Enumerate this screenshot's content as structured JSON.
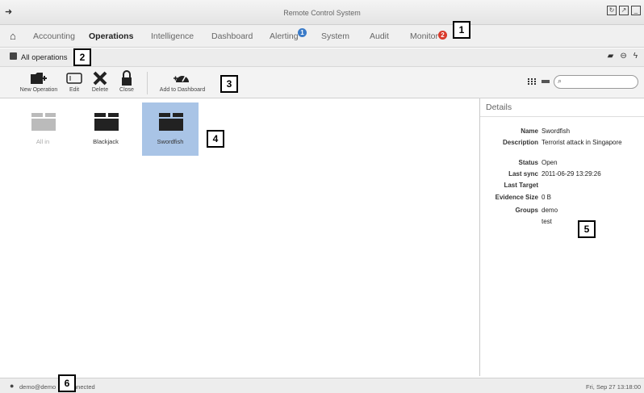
{
  "window": {
    "title": "Remote Control System"
  },
  "nav": {
    "items": [
      "Accounting",
      "Operations",
      "Intelligence",
      "Dashboard",
      "Alerting",
      "System",
      "Audit",
      "Monitor"
    ],
    "alerting_badge": "1",
    "monitor_badge": "2",
    "active": "Operations"
  },
  "section": {
    "title": "All operations"
  },
  "toolbar": {
    "new_operation": "New Operation",
    "edit": "Edit",
    "delete": "Delete",
    "close": "Close",
    "add_to_dashboard": "Add to Dashboard"
  },
  "search": {
    "placeholder": ""
  },
  "operations": [
    {
      "name": "All in",
      "state": "closed"
    },
    {
      "name": "Blackjack",
      "state": "open"
    },
    {
      "name": "Swordfish",
      "state": "open",
      "selected": true
    }
  ],
  "details": {
    "title": "Details",
    "name_label": "Name",
    "name_value": "Swordfish",
    "description_label": "Description",
    "description_value": "Terrorist attack in Singapore",
    "status_label": "Status",
    "status_value": "Open",
    "last_sync_label": "Last sync",
    "last_sync_value": "2011-06-29 13:29:26",
    "last_target_label": "Last Target",
    "last_target_value": "",
    "evidence_size_label": "Evidence Size",
    "evidence_size_value": "0 B",
    "groups_label": "Groups",
    "groups": [
      "demo",
      "test"
    ]
  },
  "status": {
    "user": "demo@demo",
    "connection": "nnected",
    "datetime": "Fri, Sep 27  13:18:00"
  },
  "callouts": [
    "1",
    "2",
    "3",
    "4",
    "5",
    "6"
  ],
  "colors": {
    "selected_bg": "#a9c4e6",
    "badge_blue": "#3a7bc8",
    "badge_red": "#d93a2b"
  },
  "icons": [
    "logout-icon",
    "refresh-icon",
    "maximize-icon",
    "minimize-icon",
    "home-icon",
    "section-icon",
    "folder-icon",
    "sign-out-icon",
    "bolt-icon",
    "new-folder-icon",
    "edit-icon",
    "delete-icon",
    "lock-icon",
    "dashboard-icon",
    "grid-view-icon",
    "list-view-icon",
    "search-icon",
    "user-icon"
  ]
}
